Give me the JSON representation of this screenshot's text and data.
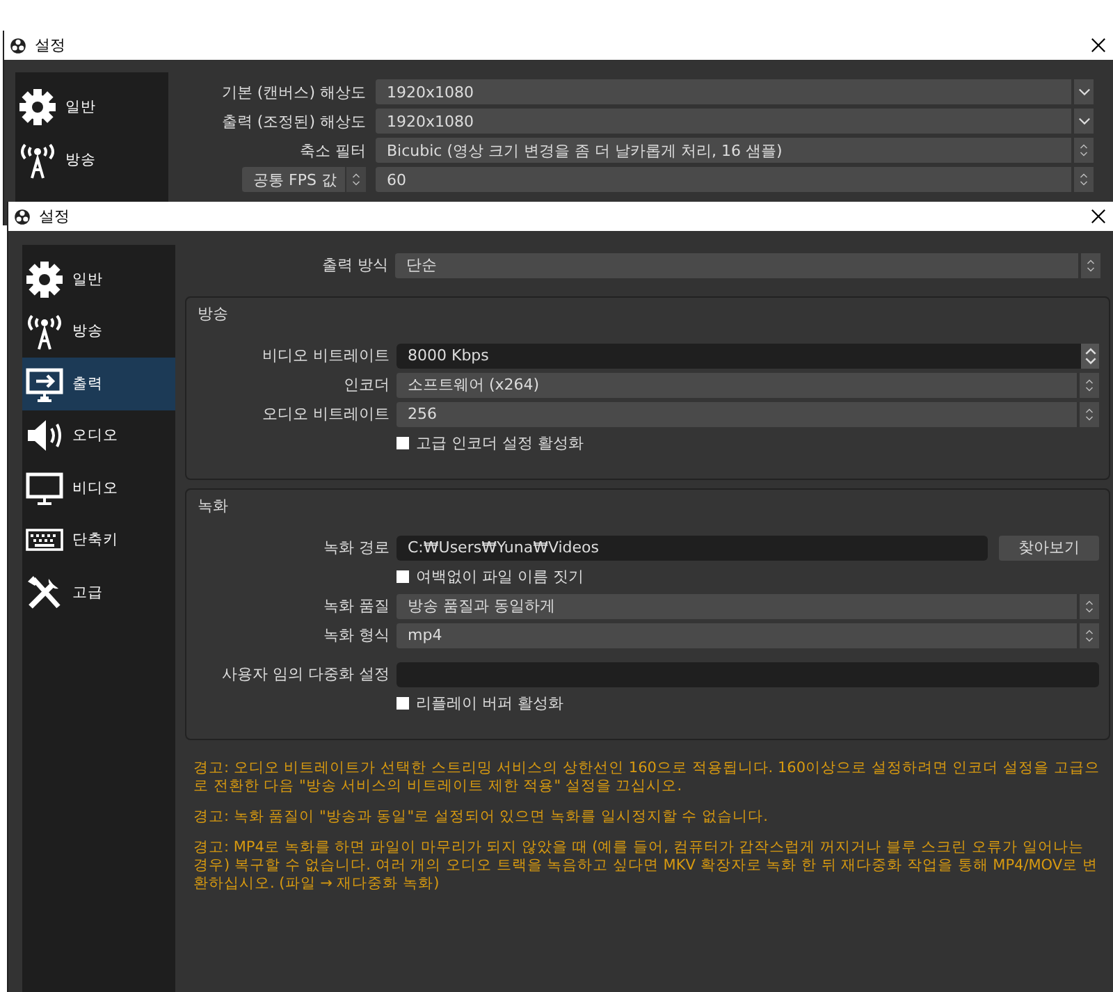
{
  "back_window": {
    "title": "설정",
    "sidebar": [
      {
        "kind": "gear",
        "label": "일반",
        "selected": false
      },
      {
        "kind": "antenna",
        "label": "방송",
        "selected": false
      }
    ],
    "rows": [
      {
        "kind": "dropdown",
        "label": "기본 (캔버스) 해상도",
        "value": "1920x1080"
      },
      {
        "kind": "dropdown",
        "label": "출력 (조정된) 해상도",
        "value": "1920x1080"
      },
      {
        "kind": "combo",
        "label": "축소 필터",
        "value": "Bicubic (영상 크기 변경을 좀 더 날카롭게 처리, 16 샘플)"
      },
      {
        "kind": "fps",
        "label": "공통 FPS 값",
        "value": "60"
      }
    ]
  },
  "front_window": {
    "title": "설정",
    "sidebar": [
      {
        "kind": "gear",
        "label": "일반",
        "selected": false
      },
      {
        "kind": "antenna",
        "label": "방송",
        "selected": false
      },
      {
        "kind": "output",
        "label": "출력",
        "selected": true
      },
      {
        "kind": "speaker",
        "label": "오디오",
        "selected": false
      },
      {
        "kind": "monitor",
        "label": "비디오",
        "selected": false
      },
      {
        "kind": "keyboard",
        "label": "단축키",
        "selected": false
      },
      {
        "kind": "tools",
        "label": "고급",
        "selected": false
      }
    ],
    "output_mode": {
      "label": "출력 방식",
      "value": "단순"
    },
    "groups": [
      {
        "title": "방송",
        "rows": [
          {
            "kind": "spin",
            "label": "비디오 비트레이트",
            "value": "8000 Kbps"
          },
          {
            "kind": "combo",
            "label": "인코더",
            "value": "소프트웨어 (x264)"
          },
          {
            "kind": "combo",
            "label": "오디오 비트레이트",
            "value": "256"
          },
          {
            "kind": "checkbox",
            "label": "고급 인코더 설정 활성화",
            "checked": false
          }
        ]
      },
      {
        "title": "녹화",
        "rows": [
          {
            "kind": "path",
            "label": "녹화 경로",
            "value": "C:₩Users₩Yuna₩Videos",
            "button": "찾아보기"
          },
          {
            "kind": "checkbox",
            "label": "여백없이 파일 이름 짓기",
            "checked": false
          },
          {
            "kind": "combo",
            "label": "녹화 품질",
            "value": "방송 품질과 동일하게"
          },
          {
            "kind": "combo",
            "label": "녹화 형식",
            "value": "mp4"
          },
          {
            "kind": "text",
            "label": "사용자 임의 다중화 설정"
          },
          {
            "kind": "checkbox",
            "label": "리플레이 버퍼 활성화",
            "checked": false
          }
        ]
      }
    ],
    "warnings": [
      "경고: 오디오 비트레이트가 선택한 스트리밍 서비스의 상한선인 160으로 적용됩니다. 160이상으로 설정하려면 인코더 설정을 고급으로 전환한 다음 \"방송 서비스의 비트레이트 제한 적용\" 설정을 끄십시오.",
      "경고: 녹화 품질이 \"방송과 동일\"로 설정되어 있으면 녹화를 일시정지할 수 없습니다.",
      "경고: MP4로 녹화를 하면 파일이 마무리가 되지 않았을 때 (예를 들어, 컴퓨터가 갑작스럽게 꺼지거나 블루 스크린 오류가 일어나는 경우) 복구할 수 없습니다. 여러 개의 오디오 트랙을 녹음하고 싶다면 MKV 확장자로 녹화 한 뒤 재다중화 작업을 통해 MP4/MOV로 변환하십시오. (파일 → 재다중화 녹화)"
    ]
  }
}
